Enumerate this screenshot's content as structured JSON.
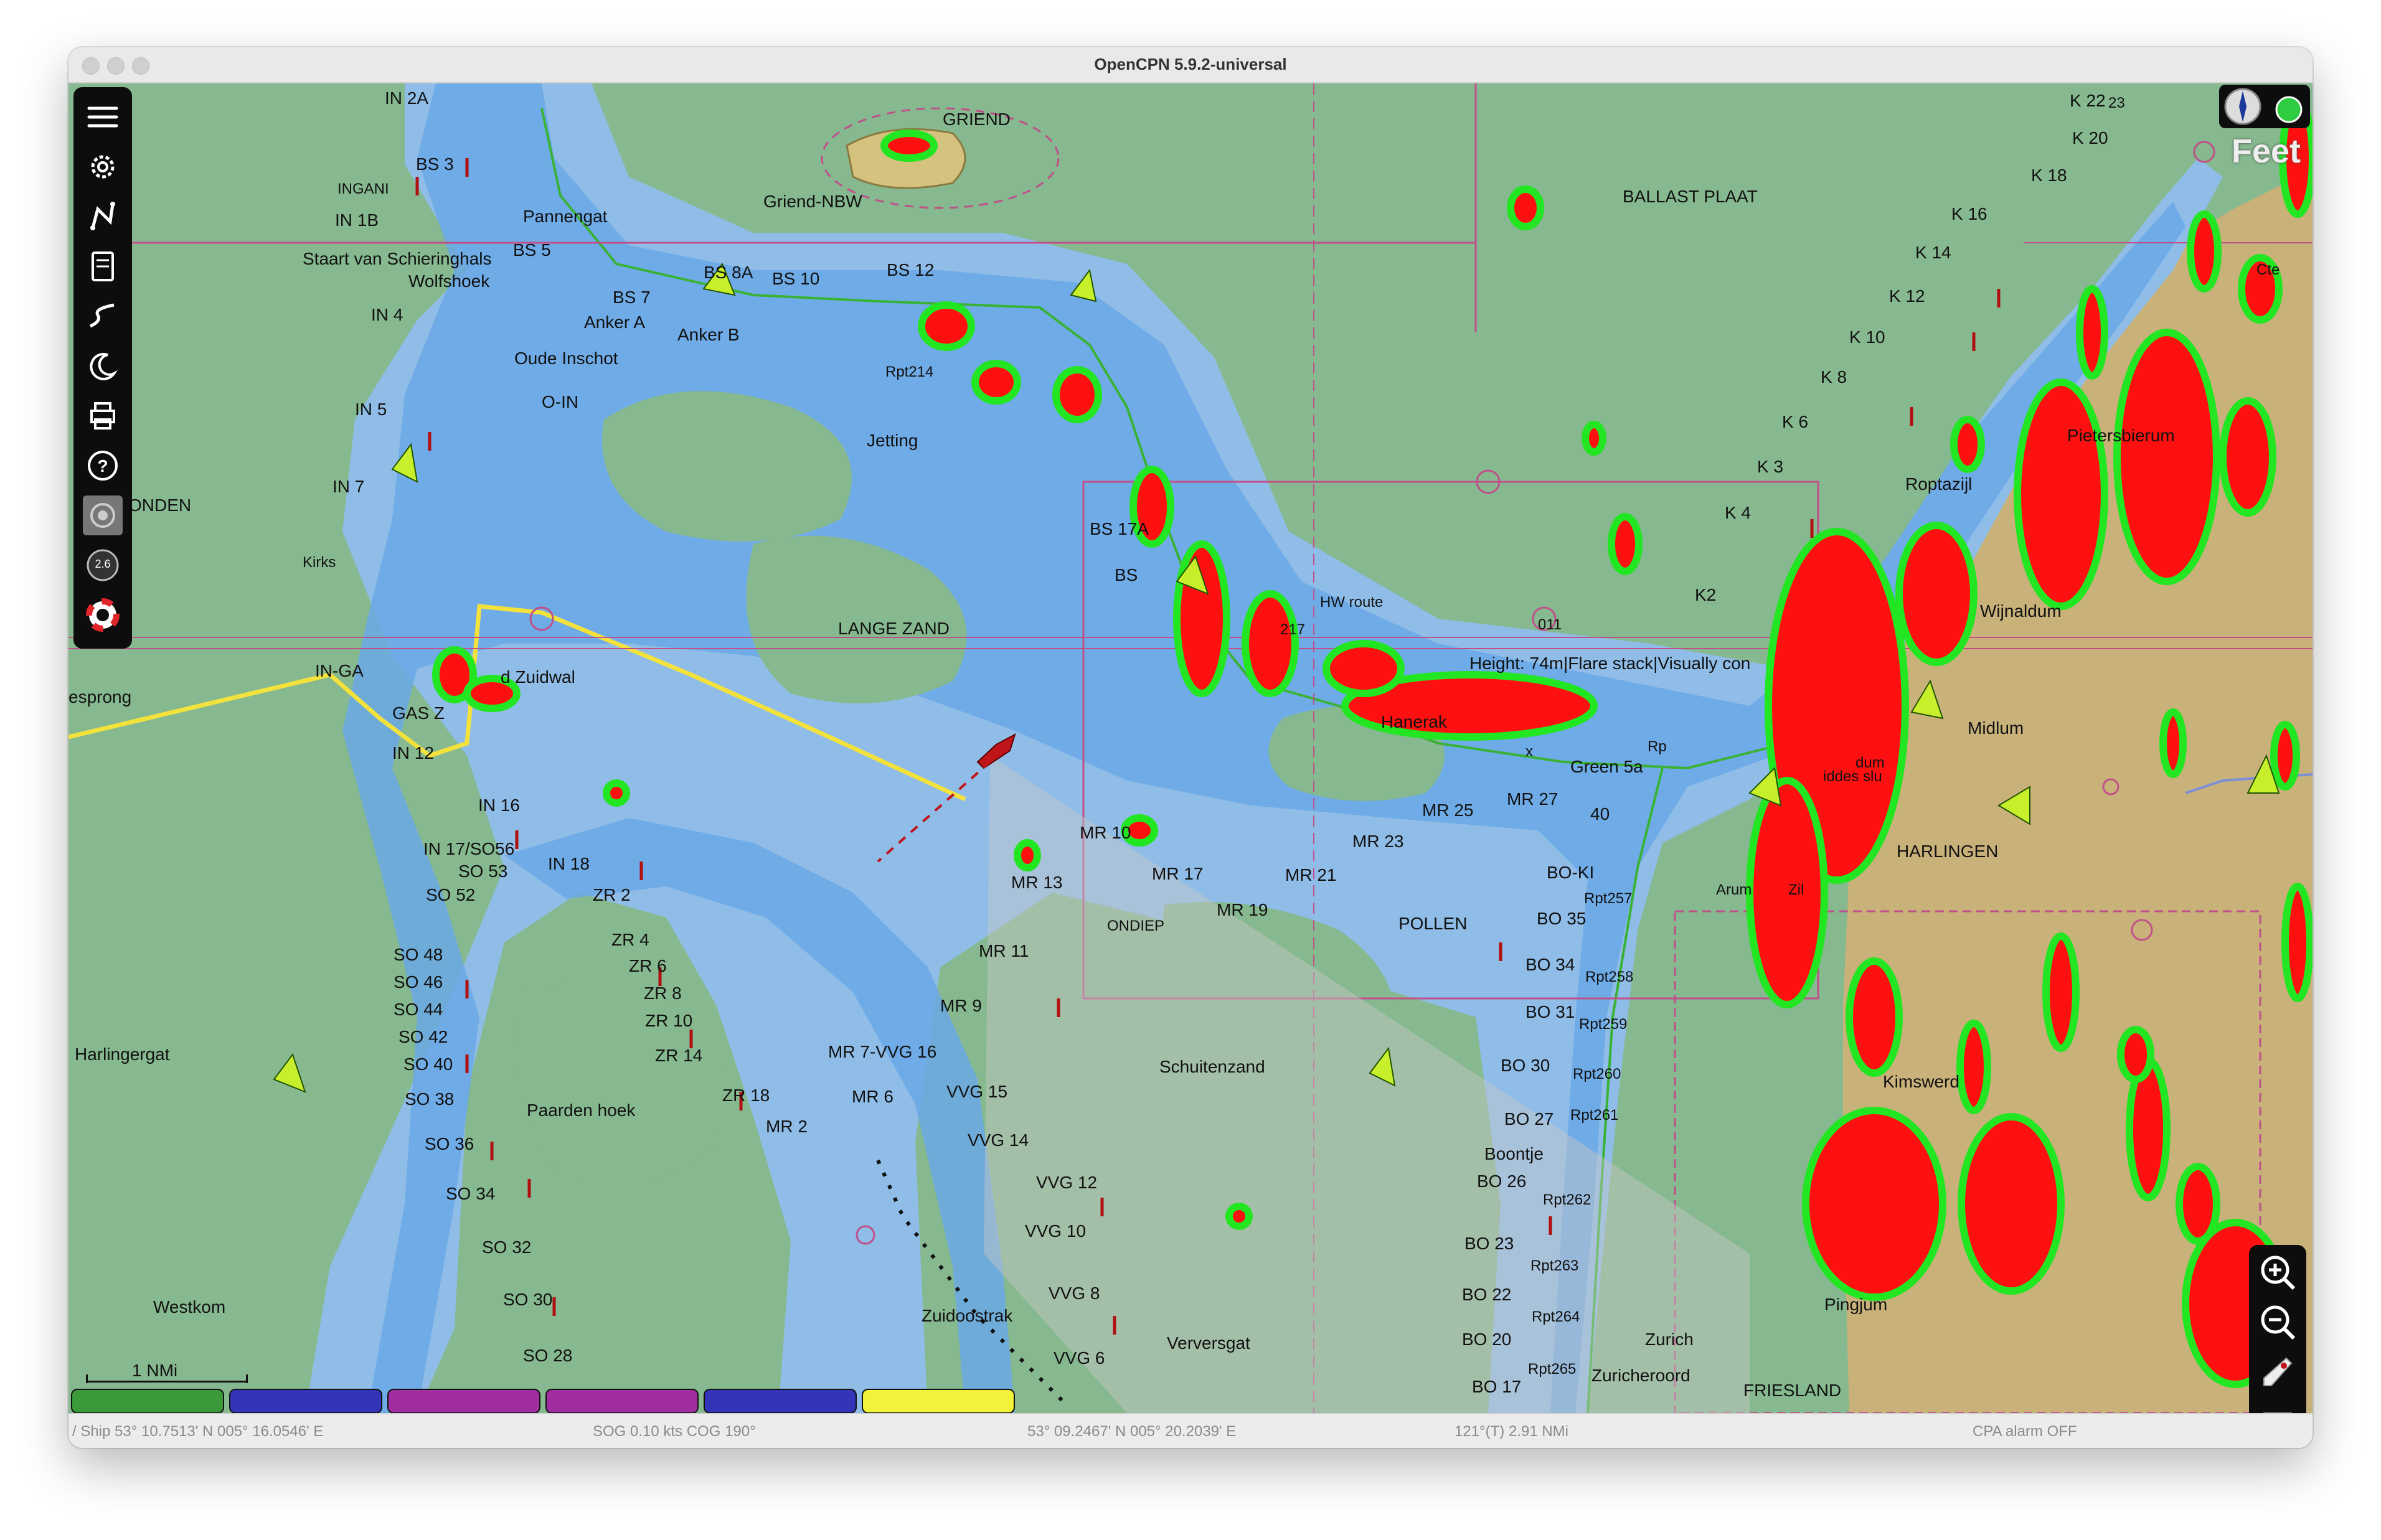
{
  "window": {
    "title": "OpenCPN 5.9.2-universal"
  },
  "map": {
    "labels": {
      "in2a": "IN 2A",
      "griend": "GRIEND",
      "bs3": "BS 3",
      "ingani": "INGANI",
      "in1b": "IN 1B",
      "pannengat": "Pannengat",
      "bs5": "BS 5",
      "griend_nbw": "Griend-NBW",
      "staart": "Staart van Schieringhals",
      "wolfshoek": "Wolfshoek",
      "bs8a": "BS 8A",
      "bs10": "BS 10",
      "bs12": "BS 12",
      "bs7": "BS 7",
      "in4": "IN 4",
      "anker_a": "Anker A",
      "anker_b": "Anker B",
      "oude_inschot": "Oude Inschot",
      "rpt214": "Rpt214",
      "oin": "O-IN",
      "in5": "IN 5",
      "jetting": "Jetting",
      "in7": "IN 7",
      "onden": "ONDEN",
      "kirks": "Kirks",
      "bs17a": "BS 17A",
      "bs": "BS",
      "hw_route": "HW route",
      "lange_zand": "LANGE ZAND",
      "r011": "011",
      "in_ga": "IN-GA",
      "zuidwal": "d Zuidwal",
      "esprong": "esprong",
      "gas": "GAS Z",
      "in12": "IN 12",
      "hanerak": "Hanerak",
      "height": "Height: 74m|Flare stack|Visually con",
      "ballast_plaat": "BALLAST PLAAT",
      "k22": "K 22",
      "k23": "23",
      "k20": "K 20",
      "k18": "K 18",
      "k16": "K 16",
      "k14": "K 14",
      "k12": "K 12",
      "k10": "K 10",
      "k8": "K 8",
      "k6": "K 6",
      "k3": "K 3",
      "k4": "K 4",
      "k2": "K2",
      "pietersbierum": "Pietersbierum",
      "roptazijl": "Roptazijl",
      "wijnaldum": "Wijnaldum",
      "in16": "IN 16",
      "in17": "IN 17/SO56",
      "so53": "SO 53",
      "in18": "IN 18",
      "so52": "SO 52",
      "zr2": "ZR 2",
      "zr4": "ZR 4",
      "so48": "SO 48",
      "so46": "SO 46",
      "zr6": "ZR 6",
      "so44": "SO 44",
      "zr8": "ZR 8",
      "so42": "SO 42",
      "zr10": "ZR 10",
      "harlingergat": "Harlingergat",
      "zr14": "ZR 14",
      "so40": "SO 40",
      "so38": "SO 38",
      "zr18": "ZR 18",
      "paarden": "Paarden hoek",
      "so36": "SO 36",
      "mr2": "MR 2",
      "so34": "SO 34",
      "so32": "SO 32",
      "so30": "SO 30",
      "so28": "SO 28",
      "westkom": "Westkom",
      "mr10": "MR 10",
      "mr13": "MR 13",
      "mr17": "MR 17",
      "mr21": "MR 21",
      "mr23": "MR 23",
      "mr25": "MR 25",
      "mr27": "MR 27",
      "mr19": "MR 19",
      "ondiep": "ONDIEP",
      "pollen": "POLLEN",
      "mr11": "MR 11",
      "mr9": "MR 9",
      "mr7": "MR 7-VVG 16",
      "mr6": "MR 6",
      "vvg15": "VVG 15",
      "vvg14": "VVG 14",
      "vvg12": "VVG 12",
      "vvg10": "VVG 10",
      "vvg8": "VVG 8",
      "vvg6": "VVG 6",
      "schuitenzand": "Schuitenzand",
      "zuidoostrak": "Zuidoostrak",
      "versgat": "Verversgat",
      "green5a": "Green 5a",
      "r40": "40",
      "bo_k": "BO-KI",
      "bo35": "BO 35",
      "rpt257": "Rpt257",
      "bo34": "BO 34",
      "rpt258": "Rpt258",
      "bo31": "BO 31",
      "rpt259": "Rpt259",
      "bo30": "BO 30",
      "rpt260": "Rpt260",
      "bo27": "BO 27",
      "rpt261": "Rpt261",
      "boontje": "Boontje",
      "bo26": "BO 26",
      "rpt262": "Rpt262",
      "bo23": "BO 23",
      "rpt263": "Rpt263",
      "bo22": "BO 22",
      "rpt264": "Rpt264",
      "bo20": "BO 20",
      "rpt265": "Rpt265",
      "bo17": "BO 17",
      "zurich": "Zurich",
      "zuricheroord": "Zuricheroord",
      "friesland": "FRIESLAND",
      "harlingen": "HARLINGEN",
      "midlum": "Midlum",
      "kimswerd": "Kimswerd",
      "pingjum": "Pingjum",
      "arum": "Arum",
      "zil": "Zil",
      "ddes_sluis": "iddes slu",
      "dum": "dum",
      "rpt": "Rp",
      "bs_r": "BS",
      "r217": "217",
      "ceter": "Cte",
      "sog_marker": "x",
      "question": "?"
    },
    "scale_label": "1 NMi",
    "feet_label": "Feet",
    "gauge_value": "2.6"
  },
  "toolbar": {
    "items": [
      "menu-icon",
      "settings-icon",
      "route-icon",
      "tracks-icon",
      "track-icon",
      "night-mode-icon",
      "print-icon",
      "help-icon",
      "ais-icon",
      "gauge-icon",
      "mob-icon"
    ]
  },
  "right_toolbar": {
    "items": [
      "zoom-in-icon",
      "zoom-out-icon",
      "north-up-icon",
      "menu-icon"
    ]
  },
  "piano_keys": [
    {
      "color": "#3a9a3a"
    },
    {
      "color": "#3434b8"
    },
    {
      "color": "#a02ea0"
    },
    {
      "color": "#a02ea0"
    },
    {
      "color": "#3434b8"
    },
    {
      "color": "#f2f23a"
    }
  ],
  "status": {
    "ship": "/ Ship 53° 10.7513' N   005° 16.0546' E",
    "sog": "SOG 0.10 kts  COG 190°",
    "cursor": "53° 09.2467' N   005° 20.2039' E",
    "bearing": "121°(T)  2.91 NMi",
    "cpa": "CPA alarm OFF"
  }
}
